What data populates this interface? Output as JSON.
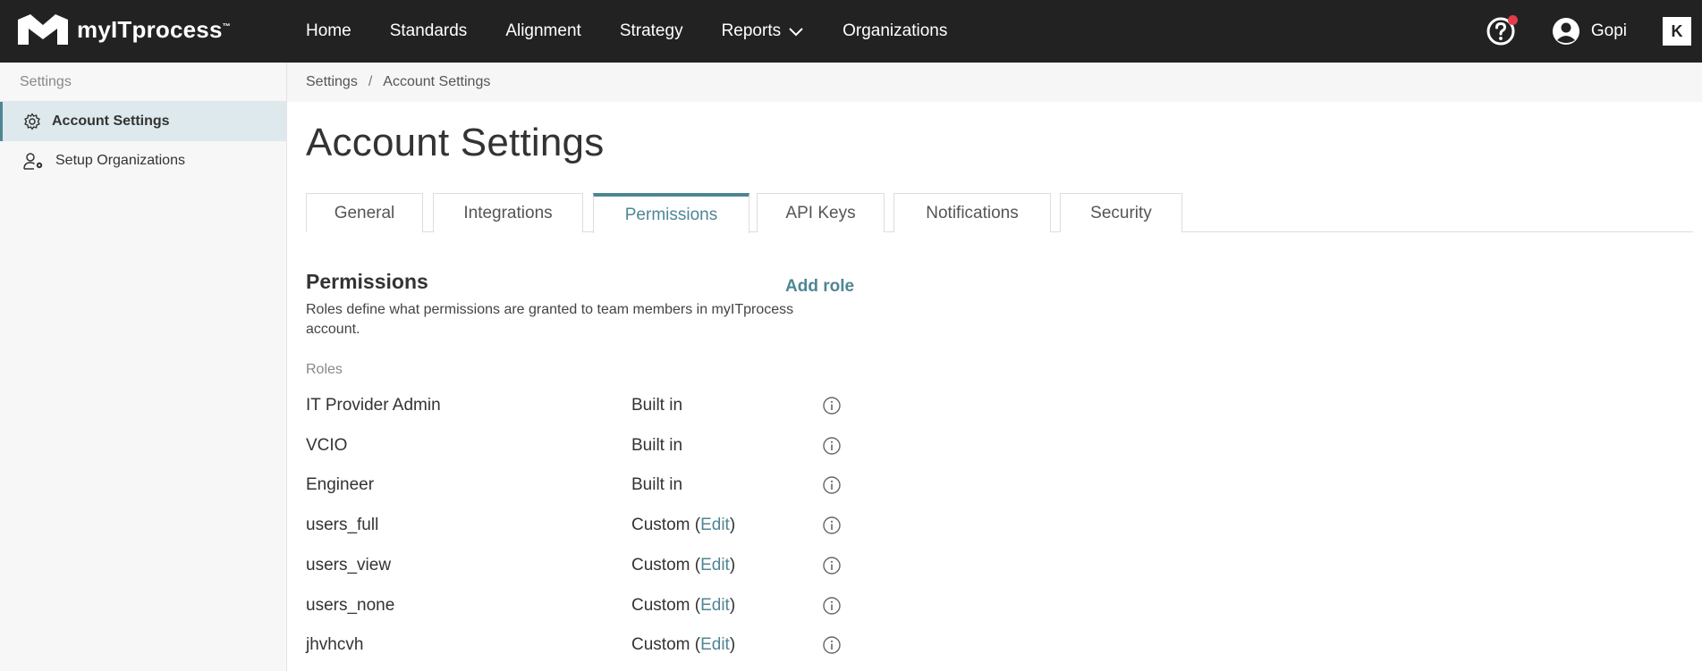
{
  "app": {
    "logo_text": "myITprocess",
    "logo_tm": "™"
  },
  "nav": {
    "items": [
      "Home",
      "Standards",
      "Alignment",
      "Strategy",
      "Reports",
      "Organizations"
    ],
    "user_name": "Gopi",
    "brand_badge": "K"
  },
  "sidebar": {
    "heading": "Settings",
    "items": [
      {
        "label": "Account Settings",
        "icon": "gear-icon",
        "active": true
      },
      {
        "label": "Setup Organizations",
        "icon": "user-gear-icon",
        "active": false
      }
    ]
  },
  "breadcrumb": {
    "root": "Settings",
    "separator": "/",
    "current": "Account Settings"
  },
  "page": {
    "title": "Account Settings",
    "tabs": [
      "General",
      "Integrations",
      "Permissions",
      "API Keys",
      "Notifications",
      "Security"
    ],
    "active_tab": "Permissions"
  },
  "permissions": {
    "title": "Permissions",
    "add_role_label": "Add role",
    "description": "Roles define what permissions are granted to team members in myITprocess account.",
    "roles_label": "Roles",
    "roles": [
      {
        "name": "IT Provider Admin",
        "type": "Built in"
      },
      {
        "name": "VCIO",
        "type": "Built in"
      },
      {
        "name": "Engineer",
        "type": "Built in"
      },
      {
        "name": "users_full",
        "type": "Custom",
        "edit_label": "Edit"
      },
      {
        "name": "users_view",
        "type": "Custom",
        "edit_label": "Edit"
      },
      {
        "name": "users_none",
        "type": "Custom",
        "edit_label": "Edit"
      },
      {
        "name": "jhvhcvh",
        "type": "Custom",
        "edit_label": "Edit"
      }
    ]
  },
  "colors": {
    "topbar": "#222222",
    "accent": "#4f8694",
    "notification_dot": "#e23b4a"
  }
}
